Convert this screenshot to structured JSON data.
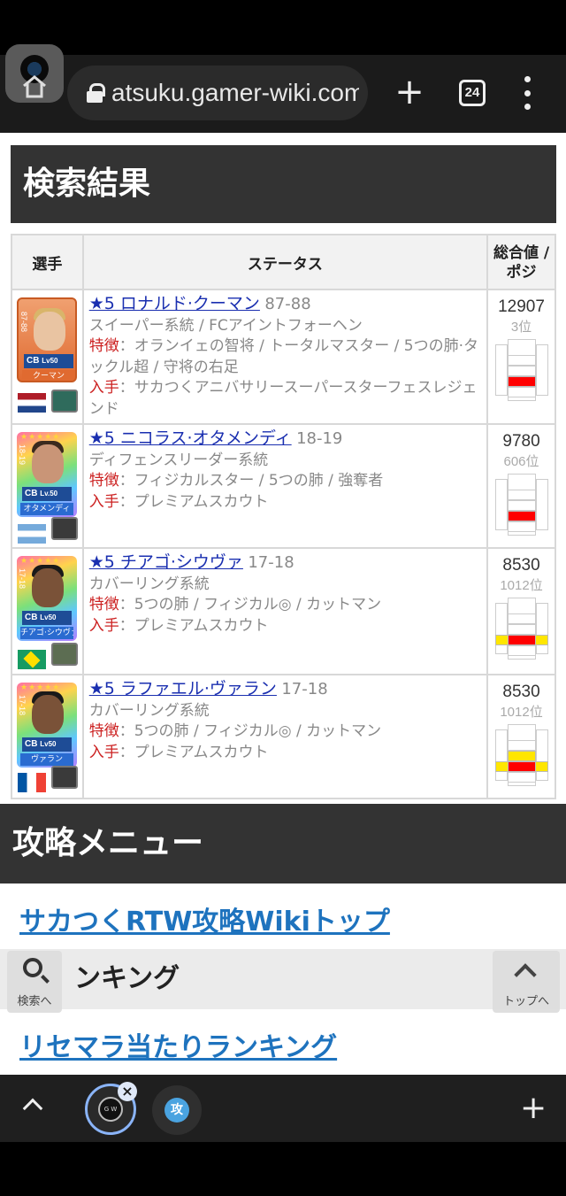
{
  "browser": {
    "url": "atsuku.gamer-wiki.com",
    "tab_count": "24",
    "new_tab_icon": "plus-icon",
    "menu_icon": "more-vert-icon"
  },
  "page": {
    "results_title": "検索結果",
    "table": {
      "headers": [
        "選手",
        "ステータス",
        "総合値 / ポジ"
      ],
      "rows": [
        {
          "card_position": "CB",
          "card_level": "Lv50",
          "card_name": "クーマン",
          "card_year": "87-88",
          "flag": "netherlands",
          "name_link": "★5 ロナルド·クーマン",
          "years": "87-88",
          "system": "スイーパー系統 / FCアイントフォーヘン",
          "trait_label": "特徴",
          "traits": "：オランイェの智将 / トータルマスター / 5つの肺·タックル超 / 守将の右足",
          "source_label": "入手",
          "source": "：サカつくアニバサリースーパースターフェスレジェンド",
          "score": "12907",
          "rank": "3位"
        },
        {
          "card_position": "CB",
          "card_level": "Lv.50",
          "card_name": "オタメンディ",
          "card_year": "18-19",
          "flag": "argentina",
          "name_link": "★5 ニコラス·オタメンディ",
          "years": "18-19",
          "system": "ディフェンスリーダー系統",
          "trait_label": "特徴",
          "traits": "：フィジカルスター / 5つの肺 / 強奪者",
          "source_label": "入手",
          "source": "：プレミアムスカウト",
          "score": "9780",
          "rank": "606位"
        },
        {
          "card_position": "CB",
          "card_level": "Lv50",
          "card_name": "チアゴ·シウヴァ",
          "card_year": "17-18",
          "flag": "brazil",
          "name_link": "★5 チアゴ·シウヴァ",
          "years": "17-18",
          "system": "カバーリング系統",
          "trait_label": "特徴",
          "traits": "：5つの肺 / フィジカル◎ / カットマン",
          "source_label": "入手",
          "source": "：プレミアムスカウト",
          "score": "8530",
          "rank": "1012位"
        },
        {
          "card_position": "CB",
          "card_level": "Lv50",
          "card_name": "ヴァラン",
          "card_year": "17-18",
          "flag": "france",
          "name_link": "★5 ラファエル·ヴァラン",
          "years": "17-18",
          "system": "カバーリング系統",
          "trait_label": "特徴",
          "traits": "：5つの肺 / フィジカル◎ / カットマン",
          "source_label": "入手",
          "source": "：プレミアムスカウト",
          "score": "8530",
          "rank": "1012位"
        }
      ]
    },
    "menu_title": "攻略メニュー",
    "link_top": "サカつくRTW攻略Wikiトップ",
    "ranking_heading": "ンキング",
    "link_reroll": "リセマラ当たりランキング",
    "float_search": "検索へ",
    "float_top": "トップへ"
  },
  "colors": {
    "heading_bg": "#333333",
    "link": "#1e73be",
    "player_link": "#1a2fb0",
    "label_red": "#cc2222",
    "pos_red": "#ff0000",
    "pos_yellow": "#ffe600"
  }
}
